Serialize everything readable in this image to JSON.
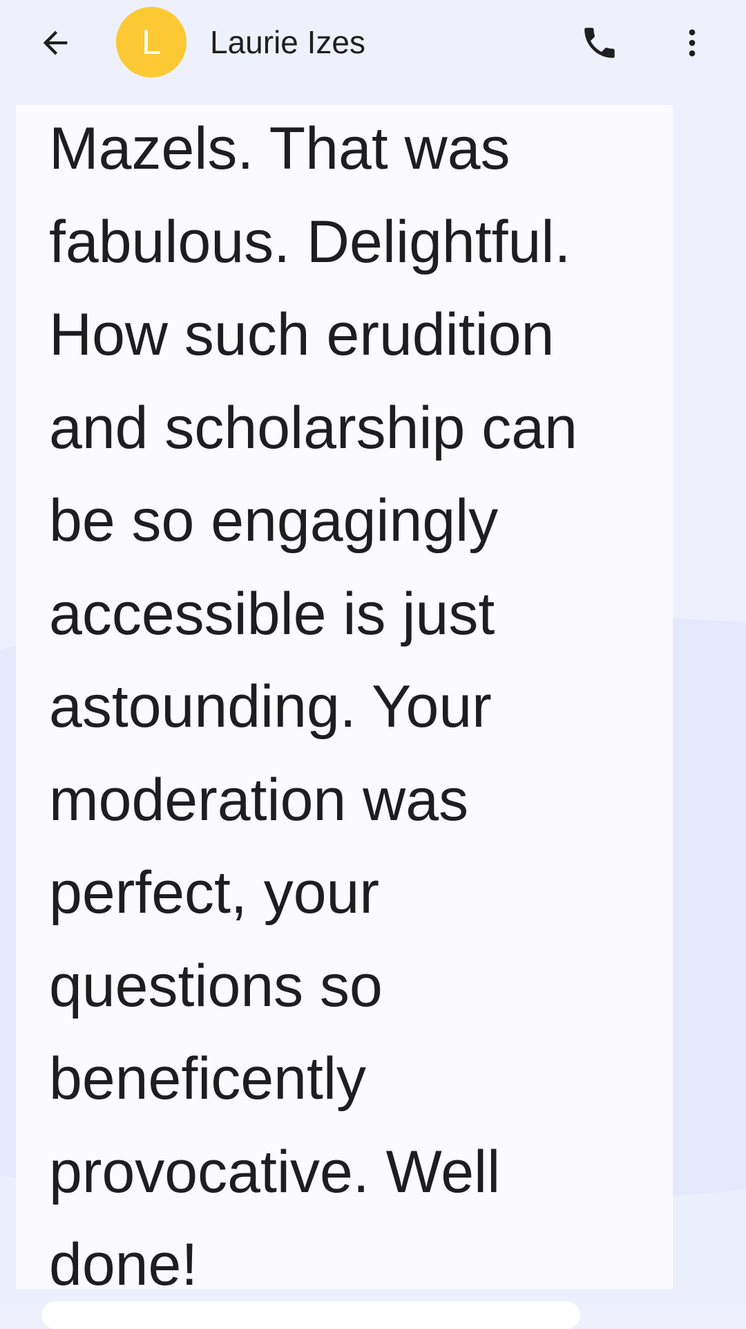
{
  "header": {
    "contact_name": "Laurie Izes",
    "avatar_initial": "L",
    "avatar_color": "#fcc934",
    "icons": {
      "back": "arrow-back-icon",
      "call": "phone-icon",
      "more": "more-vert-icon"
    }
  },
  "message": {
    "text": "Mazels. That was\nfabulous. Delightful.\nHow such erudition\nand scholarship can\nbe so engagingly\naccessible is just\nastounding. Your\nmoderation was\nperfect, your\nquestions so\nbeneficently\nprovocative. Well\ndone!"
  },
  "colors": {
    "background": "#eef1fb",
    "bubble": "#fbfbff",
    "text": "#1e1e22",
    "icon": "#1f1f1f"
  }
}
